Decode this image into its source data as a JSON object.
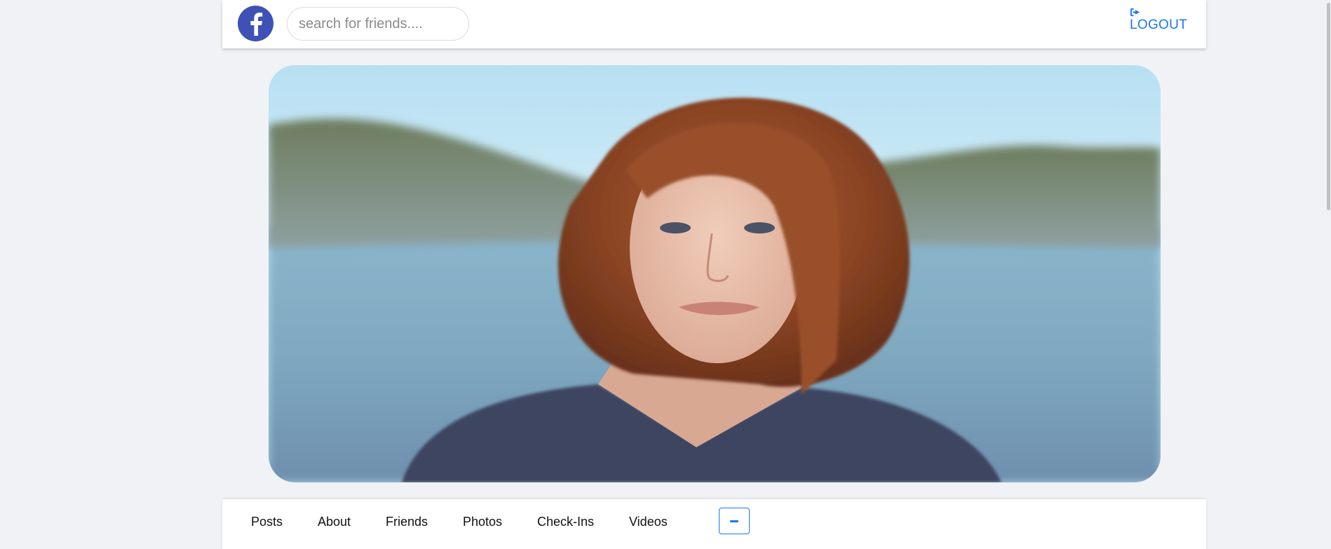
{
  "header": {
    "logo_icon": "facebook-f-icon",
    "search_placeholder": "search for friends....",
    "logout_icon": "sign-out-icon",
    "logout_label": "LOGOUT"
  },
  "cover": {
    "image": "cover-photo-portrait"
  },
  "profile_tabs": {
    "items": [
      {
        "label": "Posts"
      },
      {
        "label": "About"
      },
      {
        "label": "Friends"
      },
      {
        "label": "Photos"
      },
      {
        "label": "Check-Ins"
      },
      {
        "label": "Videos"
      }
    ],
    "more_icon": "minus-icon"
  },
  "colors": {
    "accent": "#1877f2",
    "logo": "#3f51b5",
    "background": "#f0f2f5"
  }
}
